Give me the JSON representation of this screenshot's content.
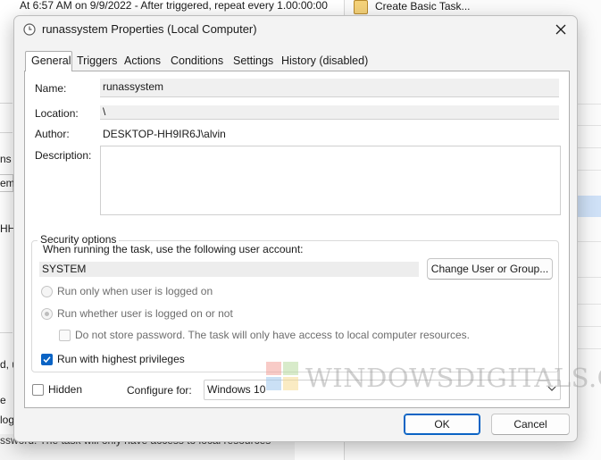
{
  "background": {
    "top_status": "At 6:57 AM on 9/9/2022 - After triggered, repeat every 1.00:00:00",
    "action_item": "Create Basic Task...",
    "left_fragments": [
      "ns",
      "em",
      "HH",
      "d, us",
      "e",
      "log",
      "ssword.  The task will only have access to local resources"
    ]
  },
  "dialog": {
    "title": "runassystem Properties (Local Computer)",
    "icons": {
      "title": "clock-icon",
      "close": "close-icon"
    },
    "tabs": [
      {
        "label": "General",
        "active": true
      },
      {
        "label": "Triggers",
        "active": false
      },
      {
        "label": "Actions",
        "active": false
      },
      {
        "label": "Conditions",
        "active": false
      },
      {
        "label": "Settings",
        "active": false
      },
      {
        "label": "History (disabled)",
        "active": false
      }
    ],
    "general": {
      "name_label": "Name:",
      "name_value": "runassystem",
      "location_label": "Location:",
      "location_value": "\\",
      "author_label": "Author:",
      "author_value": "DESKTOP-HH9IR6J\\alvin",
      "description_label": "Description:",
      "description_value": ""
    },
    "security": {
      "group_label": "Security options",
      "account_prompt": "When running the task, use the following user account:",
      "account_value": "SYSTEM",
      "change_button": "Change User or Group...",
      "radio_logged_on": {
        "label": "Run only when user is logged on",
        "selected": false,
        "enabled": false
      },
      "radio_whether": {
        "label": "Run whether user is logged on or not",
        "selected": true,
        "enabled": false
      },
      "do_not_store": {
        "label": "Do not store password.  The task will only have access to local computer resources.",
        "checked": false,
        "enabled": false
      },
      "highest_privileges": {
        "label": "Run with highest privileges",
        "checked": true
      }
    },
    "footer": {
      "hidden_label": "Hidden",
      "hidden_checked": false,
      "configure_label": "Configure for:",
      "configure_value": "Windows 10",
      "ok": "OK",
      "cancel": "Cancel"
    }
  },
  "watermark": {
    "text": "WindowsDigitals.com",
    "display": "WINDOWSDIGITALS.COM"
  },
  "colors": {
    "accent": "#0a63c4",
    "dialog_bg": "#f3f3f3",
    "panel_bg": "#ffffff"
  }
}
